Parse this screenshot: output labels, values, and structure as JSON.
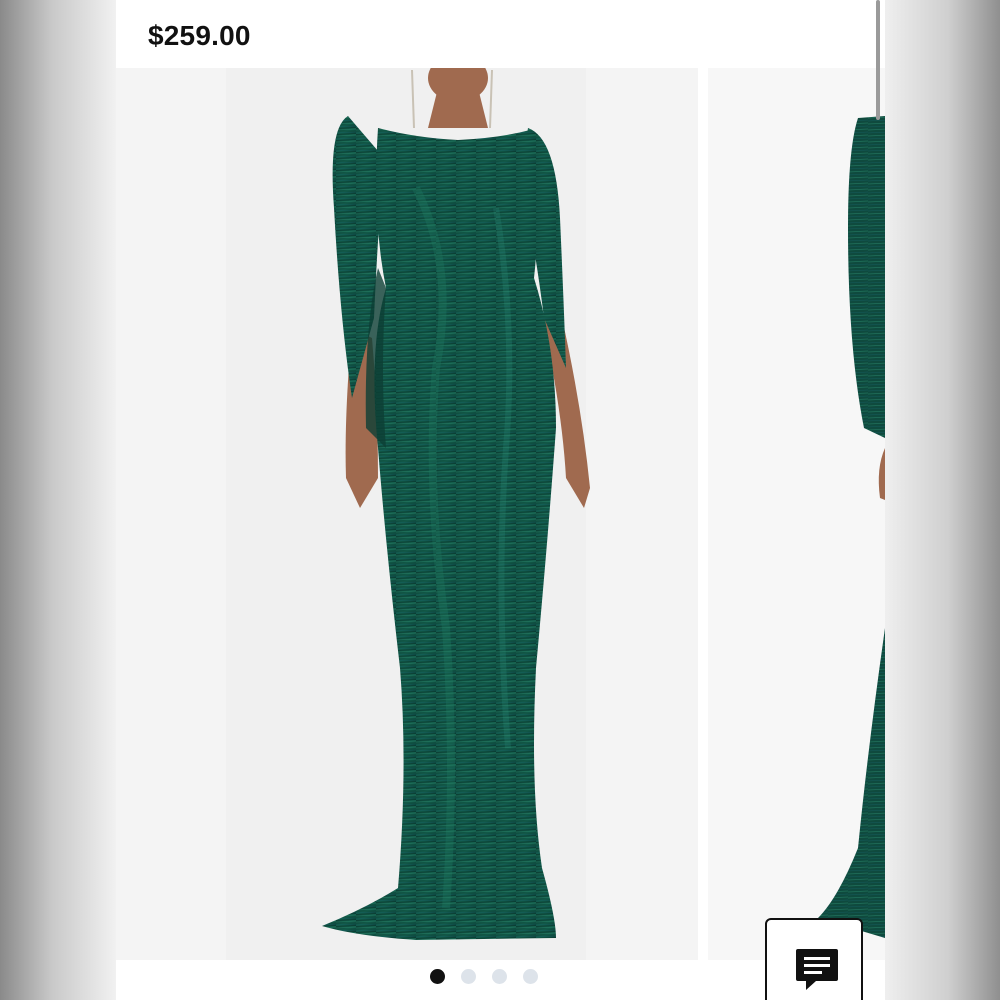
{
  "product": {
    "price": "$259.00"
  },
  "carousel": {
    "current_index": 1,
    "total_images": 4,
    "main_image": "green-metallic-gown-front",
    "next_image": "green-metallic-gown-side"
  },
  "chat": {
    "icon": "chat-bubble-icon"
  },
  "colors": {
    "gown": "#0f4a3e",
    "active_dot": "#111111",
    "inactive_dot": "#dde3ea"
  }
}
